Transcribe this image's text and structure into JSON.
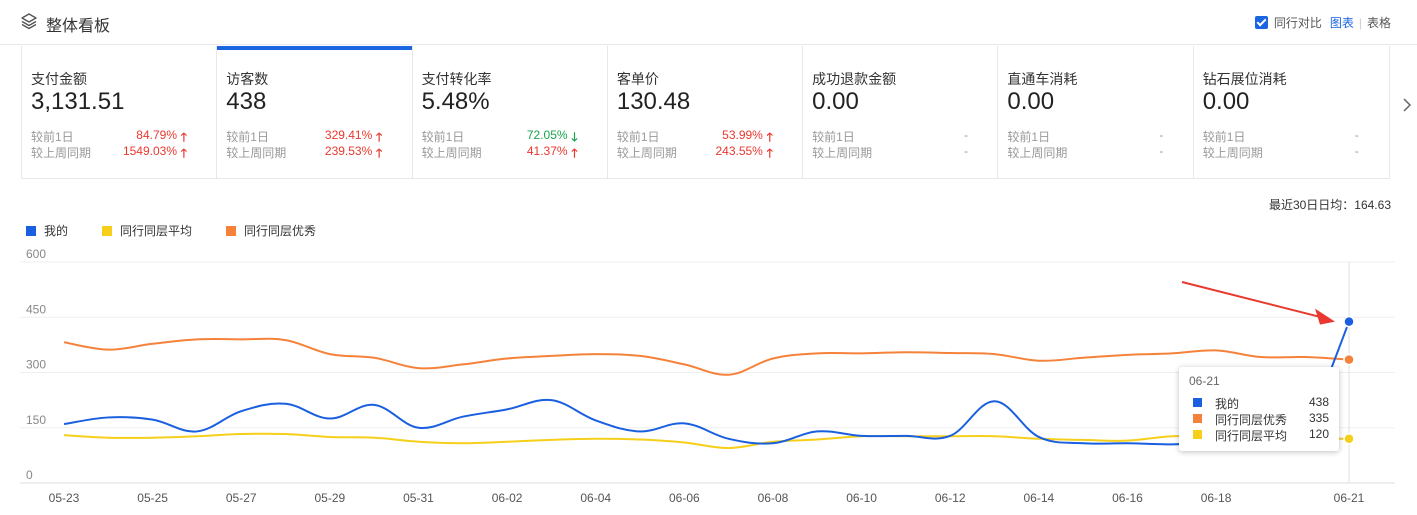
{
  "header": {
    "title": "整体看板",
    "peer_compare_label": "同行对比",
    "view_chart": "图表",
    "separator": "|",
    "view_table": "表格"
  },
  "cards": [
    {
      "label": "支付金额",
      "value": "3,131.51",
      "cmp1_label": "较前1日",
      "cmp1_pct": "84.79%",
      "cmp1_dir": "up",
      "cmp2_label": "较上周同期",
      "cmp2_pct": "1549.03%",
      "cmp2_dir": "up"
    },
    {
      "label": "访客数",
      "value": "438",
      "cmp1_label": "较前1日",
      "cmp1_pct": "329.41%",
      "cmp1_dir": "up",
      "cmp2_label": "较上周同期",
      "cmp2_pct": "239.53%",
      "cmp2_dir": "up"
    },
    {
      "label": "支付转化率",
      "value": "5.48%",
      "cmp1_label": "较前1日",
      "cmp1_pct": "72.05%",
      "cmp1_dir": "down",
      "cmp2_label": "较上周同期",
      "cmp2_pct": "41.37%",
      "cmp2_dir": "up"
    },
    {
      "label": "客单价",
      "value": "130.48",
      "cmp1_label": "较前1日",
      "cmp1_pct": "53.99%",
      "cmp1_dir": "up",
      "cmp2_label": "较上周同期",
      "cmp2_pct": "243.55%",
      "cmp2_dir": "up"
    },
    {
      "label": "成功退款金额",
      "value": "0.00",
      "cmp1_label": "较前1日",
      "cmp1_pct": "-",
      "cmp1_dir": "none",
      "cmp2_label": "较上周同期",
      "cmp2_pct": "-",
      "cmp2_dir": "none"
    },
    {
      "label": "直通车消耗",
      "value": "0.00",
      "cmp1_label": "较前1日",
      "cmp1_pct": "-",
      "cmp1_dir": "none",
      "cmp2_label": "较上周同期",
      "cmp2_pct": "-",
      "cmp2_dir": "none"
    },
    {
      "label": "钻石展位消耗",
      "value": "0.00",
      "cmp1_label": "较前1日",
      "cmp1_pct": "-",
      "cmp1_dir": "none",
      "cmp2_label": "较上周同期",
      "cmp2_pct": "-",
      "cmp2_dir": "none"
    }
  ],
  "arrows": {
    "up": "🡑",
    "down": "🡓"
  },
  "avg_label": "最近30日日均：164.63",
  "colors": {
    "mine": "#1a5fe0",
    "peer_avg": "#f5cf1a",
    "peer_top": "#f5823a",
    "red": "#e8382f",
    "green": "#1aa34a",
    "accent": "#1a66e0"
  },
  "tooltip": {
    "date": "06-21",
    "rows": [
      {
        "name": "我的",
        "value": "438"
      },
      {
        "name": "同行同层优秀",
        "value": "335"
      },
      {
        "name": "同行同层平均",
        "value": "120"
      }
    ]
  },
  "chart_data": {
    "type": "line",
    "ylim": [
      0,
      600
    ],
    "yticks": [
      "600",
      "450",
      "300",
      "150",
      "0"
    ],
    "x": [
      "05-23",
      "05-24",
      "05-25",
      "05-26",
      "05-27",
      "05-28",
      "05-29",
      "05-30",
      "05-31",
      "06-01",
      "06-02",
      "06-03",
      "06-04",
      "06-05",
      "06-06",
      "06-07",
      "06-08",
      "06-09",
      "06-10",
      "06-11",
      "06-12",
      "06-13",
      "06-14",
      "06-15",
      "06-16",
      "06-17",
      "06-18",
      "06-19",
      "06-20",
      "06-21"
    ],
    "xtick_labels": [
      "05-23",
      "05-25",
      "05-27",
      "05-29",
      "05-31",
      "06-02",
      "06-04",
      "06-06",
      "06-08",
      "06-10",
      "06-12",
      "06-14",
      "06-16",
      "06-18",
      "06-21"
    ],
    "series": [
      {
        "name": "我的",
        "key": "mine",
        "values": [
          160,
          178,
          172,
          140,
          195,
          215,
          175,
          212,
          150,
          180,
          200,
          225,
          170,
          140,
          162,
          120,
          108,
          140,
          128,
          128,
          128,
          222,
          125,
          108,
          108,
          105,
          112,
          120,
          120,
          438
        ]
      },
      {
        "name": "同行同层平均",
        "key": "peer_avg",
        "values": [
          130,
          123,
          123,
          127,
          133,
          133,
          125,
          123,
          112,
          108,
          112,
          117,
          120,
          118,
          110,
          95,
          112,
          118,
          127,
          127,
          127,
          127,
          120,
          117,
          115,
          127,
          127,
          120,
          120,
          120
        ]
      },
      {
        "name": "同行同层优秀",
        "key": "peer_top",
        "values": [
          382,
          362,
          378,
          390,
          390,
          388,
          350,
          340,
          312,
          322,
          338,
          345,
          350,
          345,
          322,
          294,
          338,
          352,
          352,
          355,
          353,
          350,
          332,
          340,
          348,
          352,
          360,
          342,
          342,
          335
        ]
      }
    ],
    "legend_position": "top-left",
    "grid": true
  }
}
